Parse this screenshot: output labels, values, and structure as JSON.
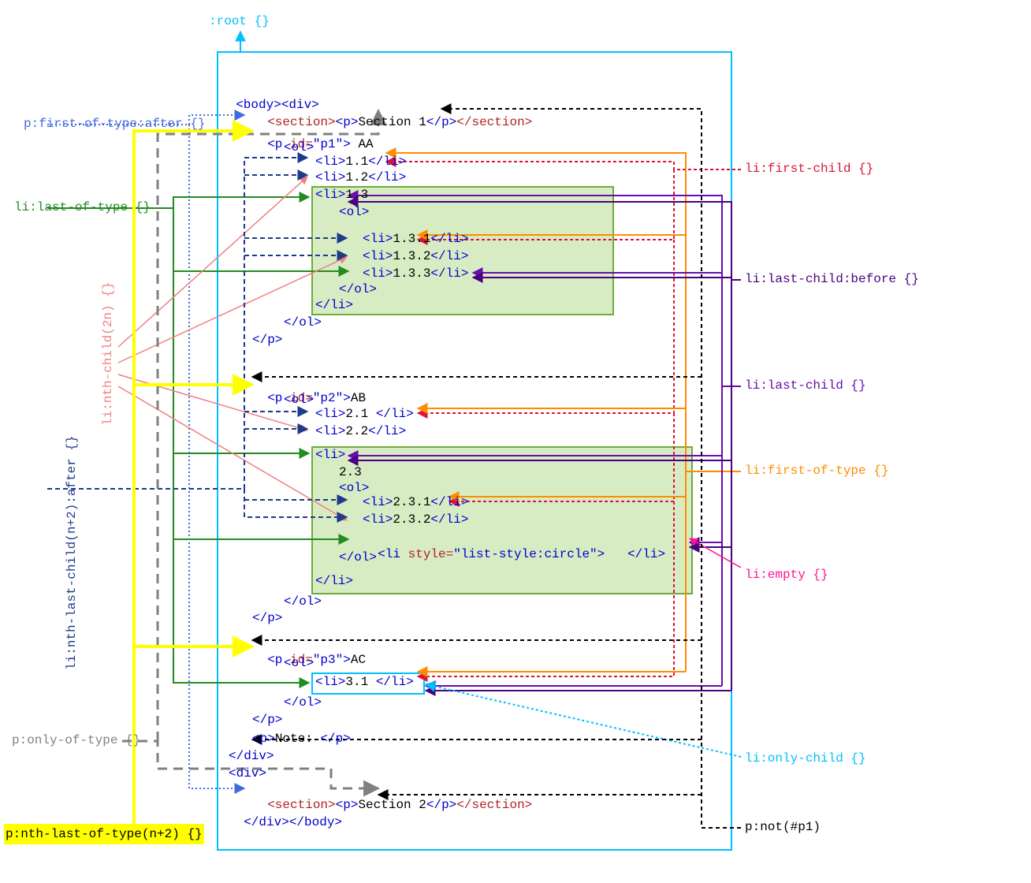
{
  "selectors": {
    "root": ":root {}",
    "p_first_of_type_after": "p:first-of-type:after {}",
    "li_last_of_type": "li:last-of-type {}",
    "li_nth_child_2n": "li:nth-child(2n) {}",
    "li_nth_last_child_after": "li:nth-last-child(n+2):after {}",
    "p_only_of_type": "p:only-of-type {}",
    "p_nth_last_of_type": "p:nth-last-of-type(n+2) {}",
    "li_first_child": "li:first-child {}",
    "li_last_child_before": "li:last-child:before {}",
    "li_last_child": "li:last-child {}",
    "li_first_of_type": "li:first-of-type {}",
    "li_empty": "li:empty {}",
    "li_only_child": "li:only-child {}",
    "p_not_p1": "p:not(#p1)"
  },
  "code": {
    "body_open": "<body>",
    "div_open": "<div>",
    "section1_open": "<section>",
    "p_open": "<p>",
    "section1_text": "Section 1",
    "p_close": "</p>",
    "section_close": "</section>",
    "p_id_open1": "<p ",
    "id_attr": "id=",
    "p1_id": "\"p1\"",
    "p1_close_tag": ">",
    "p1_text": " AA",
    "ol_open": "<ol>",
    "li_open": "<li>",
    "li_close": "</li>",
    "li_1_1": "1.1",
    "li_1_2": "1.2",
    "li_1_3": "1.3",
    "li_1_3_1": "1.3.1",
    "li_1_3_2": "1.3.2",
    "li_1_3_3": "1.3.3",
    "ol_close": "</ol>",
    "p2_id": "\"p2\"",
    "p2_text": "AB",
    "li_2_1": "2.1 ",
    "li_2_2": "2.2",
    "li_2_3": "2.3",
    "li_2_3_1": "2.3.1",
    "li_2_3_2": "2.3.2",
    "style_attr": "style=",
    "style_val": "\"list-style:circle\"",
    "style_gt": ">   ",
    "p3_id": "\"p3\"",
    "p3_text": "AC",
    "li_3_1": "3.1 ",
    "note_text": "Note: ",
    "div_close": "</div>",
    "section2_text": "Section 2",
    "body_close": "</body>"
  },
  "colors": {
    "root": "#00bfff",
    "first_of_type_after": "#4169e1",
    "last_of_type": "#228b22",
    "nth_child_2n": "#f08080",
    "nth_last_child_after": "#1e3a8a",
    "only_of_type": "#808080",
    "nth_last_of_type": "#000000",
    "first_child": "#dc143c",
    "last_child_before": "#4b0082",
    "last_child": "#6a0dad",
    "first_of_type": "#ff8c00",
    "empty": "#ff1493",
    "only_child": "#00bfff",
    "not_p1": "#000000"
  }
}
